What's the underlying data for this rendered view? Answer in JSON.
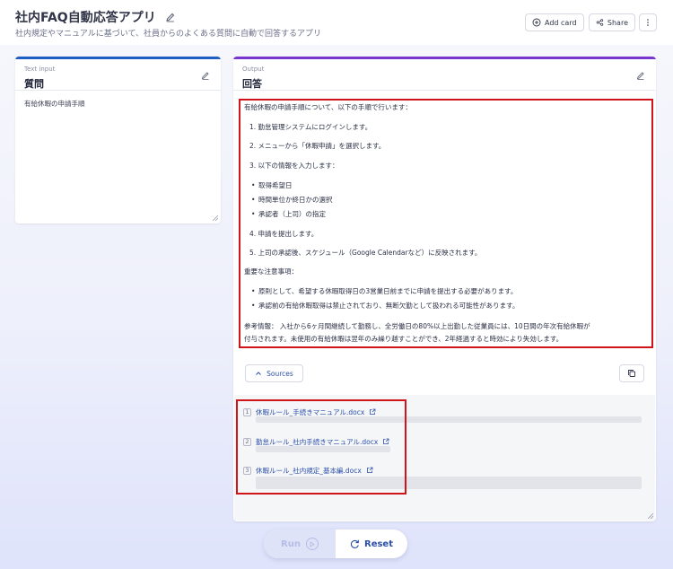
{
  "header": {
    "title": "社内FAQ自動応答アプリ",
    "subtitle": "社内規定やマニュアルに基づいて、社員からのよくある質問に自動で回答するアプリ",
    "add_card_label": "Add card",
    "share_label": "Share"
  },
  "input_panel": {
    "type_label": "Text input",
    "title": "質問",
    "value": "有給休暇の申請手順"
  },
  "output_panel": {
    "type_label": "Output",
    "title": "回答",
    "answer": {
      "intro": "有給休暇の申請手順について、以下の手順で行います：",
      "steps": [
        "1. 勤怠管理システムにログインします。",
        "2. メニューから「休暇申請」を選択します。",
        "3. 以下の情報を入力します："
      ],
      "inputs": [
        "取得希望日",
        "時間単位か終日かの選択",
        "承認者（上司）の指定"
      ],
      "steps_after": [
        "4. 申請を提出します。",
        "5. 上司の承認後、スケジュール（Google Calendarなど）に反映されます。"
      ],
      "notes_heading": "重要な注意事項：",
      "notes": [
        "原則として、希望する休暇取得日の3営業日前までに申請を提出する必要があります。",
        "承認前の有給休暇取得は禁止されており、無断欠勤として扱われる可能性があります。"
      ],
      "reference_line1": "参考情報： 入社から6ヶ月間継続して勤務し、全労働日の80%以上出勤した従業員には、10日間の年次有給休暇が",
      "reference_line2": "付与されます。未使用の有給休暇は翌年のみ繰り越すことができ、2年経過すると時効により失効します。"
    },
    "sources_label": "Sources",
    "sources": [
      {
        "num": "1",
        "title": "休暇ルール_手続きマニュアル.docx"
      },
      {
        "num": "2",
        "title": "勤怠ルール_社内手続きマニュアル.docx"
      },
      {
        "num": "3",
        "title": "休暇ルール_社内規定_基本編.docx"
      }
    ]
  },
  "actions": {
    "run_label": "Run",
    "reset_label": "Reset"
  },
  "colors": {
    "input_accent": "#1f5fc4",
    "output_accent": "#7a35cf",
    "highlight_border": "#d0141a",
    "link": "#2b4fa8"
  },
  "icons": [
    "edit-icon",
    "add-card-icon",
    "share-icon",
    "more-icon",
    "chevron-up-icon",
    "copy-icon",
    "external-link-icon",
    "play-icon",
    "reset-icon",
    "resize-handle-icon"
  ]
}
